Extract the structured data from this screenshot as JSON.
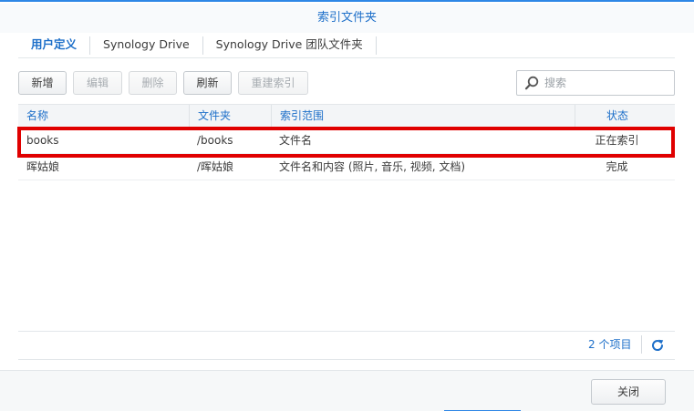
{
  "window": {
    "title": "索引文件夹"
  },
  "tabs": [
    {
      "label": "用户定义",
      "active": true
    },
    {
      "label": "Synology Drive",
      "active": false
    },
    {
      "label": "Synology Drive 团队文件夹",
      "active": false
    }
  ],
  "toolbar": {
    "add": "新增",
    "edit": "编辑",
    "delete": "删除",
    "refresh": "刷新",
    "reindex": "重建索引"
  },
  "search": {
    "placeholder": "搜索",
    "icon": "search-icon"
  },
  "table": {
    "columns": [
      "名称",
      "文件夹",
      "索引范围",
      "状态"
    ],
    "rows": [
      {
        "name": "books",
        "folder": "/books",
        "scope": "文件名",
        "status": "正在索引",
        "highlighted": true
      },
      {
        "name": "晖姑娘",
        "folder": "/晖姑娘",
        "scope": "文件名和内容 (照片, 音乐, 视频, 文档)",
        "status": "完成",
        "highlighted": false
      }
    ]
  },
  "footer": {
    "item_count": "2 个项目",
    "refresh_icon": "refresh-icon"
  },
  "actions": {
    "close": "关闭"
  },
  "colors": {
    "accent": "#1d6fc9",
    "highlight": "#e00000"
  }
}
